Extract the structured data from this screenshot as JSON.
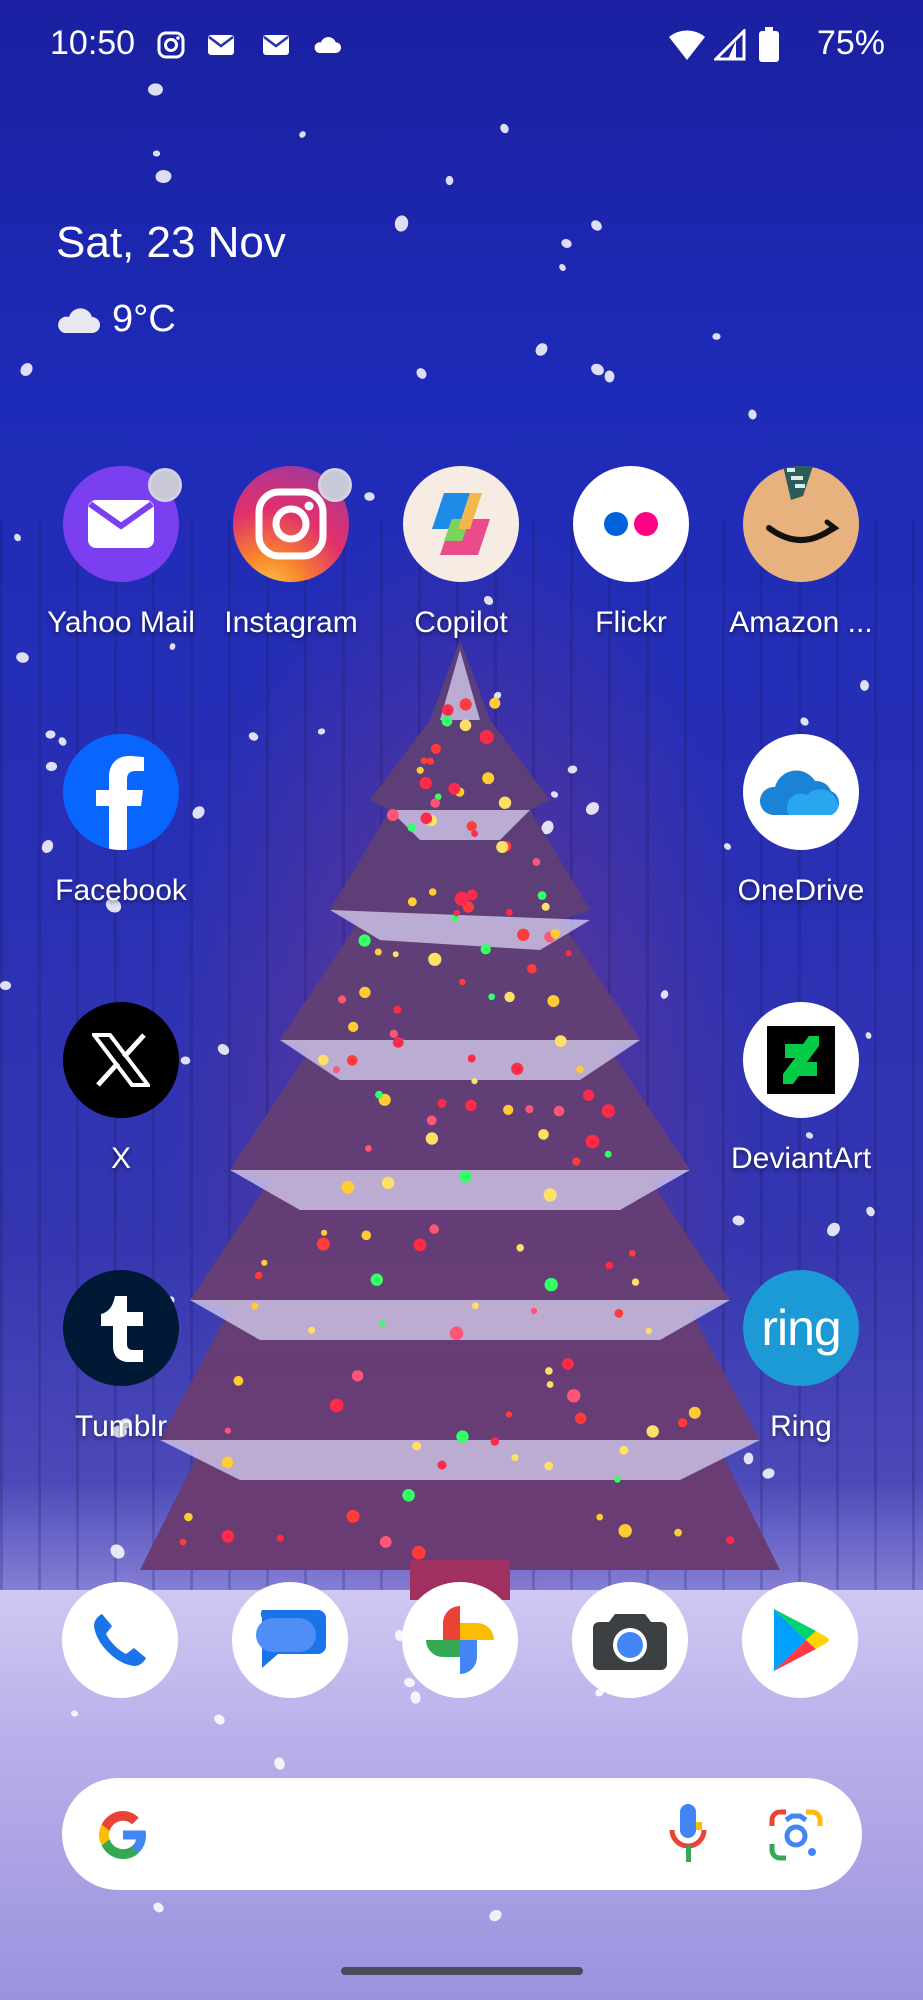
{
  "status_bar": {
    "time": "10:50",
    "notification_icons": [
      "instagram-icon",
      "mail-icon",
      "mail-icon",
      "cloud-icon"
    ],
    "system_icons": [
      "wifi-icon",
      "signal-icon",
      "battery-icon"
    ],
    "battery": "75%"
  },
  "at_a_glance": {
    "date": "Sat, 23 Nov",
    "weather_icon": "cloud-icon",
    "temperature": "9°C"
  },
  "apps": {
    "row1": [
      {
        "label": "Yahoo Mail",
        "icon": "yahoo-mail-icon",
        "color": "#7b3ff2",
        "badge": true
      },
      {
        "label": "Instagram",
        "icon": "instagram-icon",
        "color": "#e1306c",
        "badge": true
      },
      {
        "label": "Copilot",
        "icon": "copilot-icon",
        "color": "#f6ece4",
        "badge": false
      },
      {
        "label": "Flickr",
        "icon": "flickr-icon",
        "color": "#ffffff",
        "badge": false
      },
      {
        "label": "Amazon ...",
        "icon": "amazon-icon",
        "color": "#e8b27f",
        "badge": false
      }
    ],
    "facebook": {
      "label": "Facebook",
      "icon": "facebook-icon",
      "color": "#0866ff"
    },
    "onedrive": {
      "label": "OneDrive",
      "icon": "onedrive-icon",
      "color": "#ffffff"
    },
    "x": {
      "label": "X",
      "icon": "x-icon",
      "color": "#000000"
    },
    "deviantart": {
      "label": "DeviantArt",
      "icon": "deviantart-icon",
      "color": "#ffffff"
    },
    "tumblr": {
      "label": "Tumblr",
      "icon": "tumblr-icon",
      "color": "#001935"
    },
    "ring": {
      "label": "Ring",
      "icon": "ring-icon",
      "color": "#1c9ad6",
      "logo_text": "ring"
    }
  },
  "dock": [
    "phone-icon",
    "messages-icon",
    "photos-icon",
    "camera-icon",
    "play-store-icon"
  ],
  "search": {
    "logo": "google-g-icon",
    "mic": "microphone-icon",
    "lens": "google-lens-icon"
  }
}
